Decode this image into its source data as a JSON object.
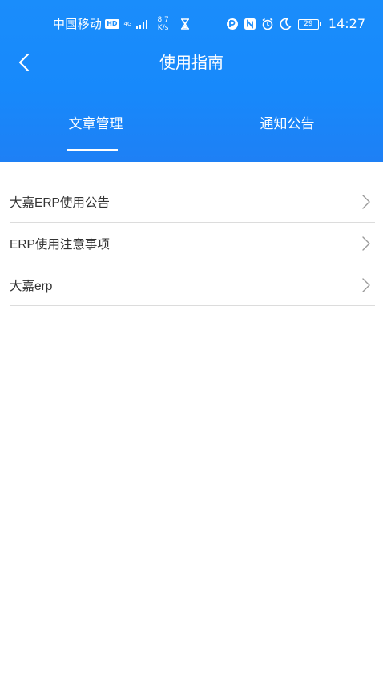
{
  "status_bar": {
    "carrier": "中国移动",
    "hd": "HD",
    "network": "4G",
    "speed_value": "8.7",
    "speed_unit": "K/s",
    "battery": "29",
    "time": "14:27"
  },
  "header": {
    "title": "使用指南"
  },
  "tabs": [
    {
      "label": "文章管理",
      "active": true
    },
    {
      "label": "通知公告",
      "active": false
    }
  ],
  "list": {
    "items": [
      {
        "label": "大嘉ERP使用公告"
      },
      {
        "label": "ERP使用注意事项"
      },
      {
        "label": "大嘉erp"
      }
    ]
  },
  "colors": {
    "header_blue": "#1a8dfb",
    "text": "#333333",
    "divider": "#dcdcdc"
  }
}
